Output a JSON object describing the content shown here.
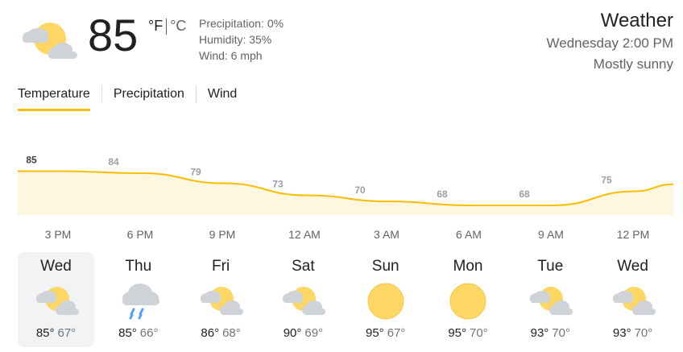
{
  "current": {
    "icon": "partly-cloudy-icon",
    "temperature": "85",
    "unit_f": "°F",
    "unit_c": "°C",
    "precipitation": "Precipitation: 0%",
    "humidity": "Humidity: 35%",
    "wind": "Wind: 6 mph"
  },
  "header": {
    "title": "Weather",
    "datetime": "Wednesday 2:00 PM",
    "condition": "Mostly sunny"
  },
  "tabs": [
    {
      "label": "Temperature",
      "active": true
    },
    {
      "label": "Precipitation",
      "active": false
    },
    {
      "label": "Wind",
      "active": false
    }
  ],
  "chart_data": {
    "type": "area",
    "x": [
      "3 PM",
      "6 PM",
      "9 PM",
      "12 AM",
      "3 AM",
      "6 AM",
      "9 AM",
      "12 PM"
    ],
    "values": [
      85,
      84,
      79,
      73,
      70,
      68,
      68,
      75
    ],
    "labels": [
      "85",
      "84",
      "79",
      "73",
      "70",
      "68",
      "68",
      "75"
    ],
    "colors": {
      "line": "#fbbc04",
      "fill": "#fef7e0"
    }
  },
  "days": [
    {
      "name": "Wed",
      "icon": "partly-cloudy-icon",
      "high": "85°",
      "low": "67°",
      "selected": true
    },
    {
      "name": "Thu",
      "icon": "rain-icon",
      "high": "85°",
      "low": "66°",
      "selected": false
    },
    {
      "name": "Fri",
      "icon": "partly-cloudy-icon",
      "high": "86°",
      "low": "68°",
      "selected": false
    },
    {
      "name": "Sat",
      "icon": "partly-cloudy-icon",
      "high": "90°",
      "low": "69°",
      "selected": false
    },
    {
      "name": "Sun",
      "icon": "sun-icon",
      "high": "95°",
      "low": "67°",
      "selected": false
    },
    {
      "name": "Mon",
      "icon": "sun-icon",
      "high": "95°",
      "low": "70°",
      "selected": false
    },
    {
      "name": "Tue",
      "icon": "partly-cloudy-icon",
      "high": "93°",
      "low": "70°",
      "selected": false
    },
    {
      "name": "Wed",
      "icon": "partly-cloudy-icon",
      "high": "93°",
      "low": "70°",
      "selected": false
    }
  ]
}
